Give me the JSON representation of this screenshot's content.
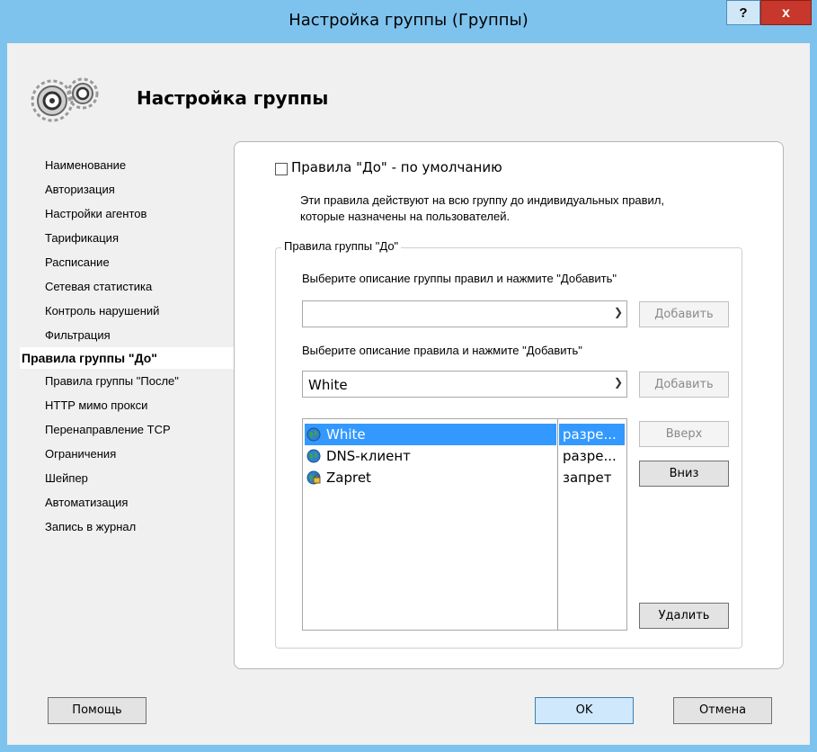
{
  "window": {
    "title": "Настройка группы (Группы)",
    "help_label": "?",
    "close_label": "x"
  },
  "header": {
    "title": "Настройка группы"
  },
  "sidebar": {
    "items": [
      {
        "label": "Наименование"
      },
      {
        "label": "Авторизация"
      },
      {
        "label": "Настройки агентов"
      },
      {
        "label": "Тарификация"
      },
      {
        "label": "Расписание"
      },
      {
        "label": "Сетевая статистика"
      },
      {
        "label": "Контроль нарушений"
      },
      {
        "label": "Фильтрация"
      },
      {
        "label": "Правила группы \"До\"",
        "active": true
      },
      {
        "label": "Правила группы \"После\""
      },
      {
        "label": "HTTP мимо прокси"
      },
      {
        "label": "Перенаправление TCP"
      },
      {
        "label": "Ограничения"
      },
      {
        "label": "Шейпер"
      },
      {
        "label": "Автоматизация"
      },
      {
        "label": "Запись в журнал"
      }
    ]
  },
  "main": {
    "default_checkbox_label": "Правила \"До\" - по умолчанию",
    "default_checked": false,
    "description_line1": "Эти правила действуют на всю группу до индивидуальных правил,",
    "description_line2": "которые назначены на пользователей.",
    "group_title": "Правила группы \"До\"",
    "group_rules_prompt": "Выберите описание группы правил и нажмите \"Добавить\"",
    "group_rules_value": "",
    "add_group_label": "Добавить",
    "rule_prompt": "Выберите описание правила и нажмите \"Добавить\"",
    "rule_value": "White",
    "add_rule_label": "Добавить",
    "rules": [
      {
        "name": "White",
        "action": "разре...",
        "selected": true,
        "icon": "globe-check-icon"
      },
      {
        "name": "DNS-клиент",
        "action": "разре...",
        "selected": false,
        "icon": "globe-check-icon"
      },
      {
        "name": "Zapret",
        "action": "запрет",
        "selected": false,
        "icon": "globe-lock-icon"
      }
    ],
    "up_label": "Вверх",
    "down_label": "Вниз",
    "delete_label": "Удалить"
  },
  "footer": {
    "help_label": "Помощь",
    "ok_label": "OK",
    "cancel_label": "Отмена"
  },
  "colors": {
    "frame": "#7ec3ee",
    "close": "#c7372c",
    "selection": "#3399ff"
  }
}
